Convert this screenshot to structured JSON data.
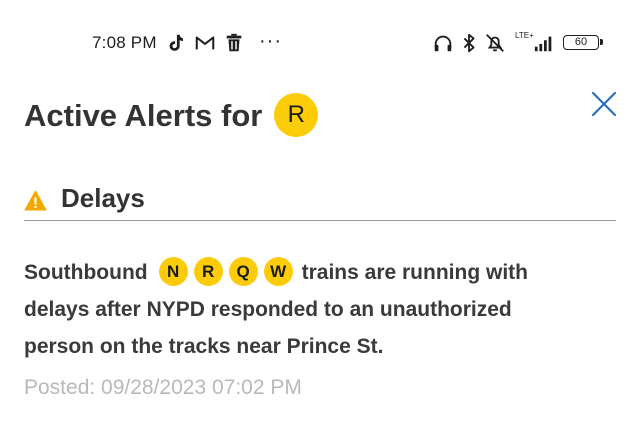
{
  "status_bar": {
    "time": "7:08 PM",
    "overflow": "···",
    "network_label": "LTE+",
    "battery": "60",
    "icons": [
      "tiktok-icon",
      "gmail-icon",
      "delete-icon",
      "headphones-icon",
      "bluetooth-icon",
      "mute-icon",
      "signal-icon",
      "battery-icon"
    ]
  },
  "header": {
    "title": "Active Alerts for",
    "route": "R"
  },
  "section": {
    "title": "Delays",
    "icon": "warning-icon"
  },
  "alert": {
    "prefix": "Southbound",
    "routes": [
      "N",
      "R",
      "Q",
      "W"
    ],
    "line1_suffix": "trains are running with",
    "line2": "delays after NYPD responded to an unauthorized",
    "line3": "person on the tracks near Prince St.",
    "posted": "Posted: 09/28/2023 07:02 PM"
  },
  "colors": {
    "route_yellow": "#fccc0a",
    "warning_yellow": "#f2a900",
    "close_blue": "#2a6ebb",
    "text_dark": "#333333",
    "text_muted": "#b9b9b9"
  }
}
